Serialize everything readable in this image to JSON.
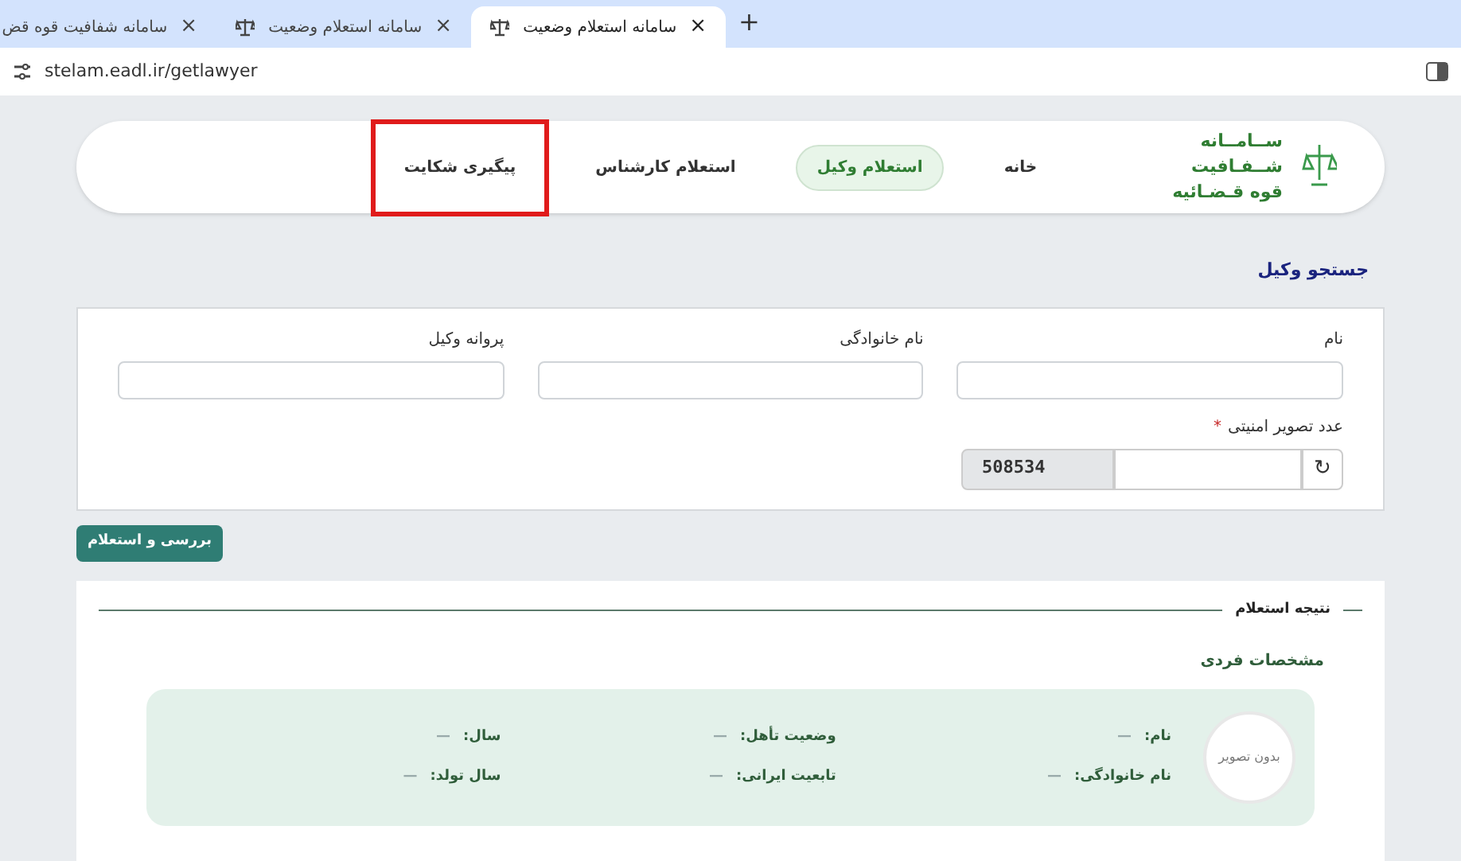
{
  "browser": {
    "tabs": [
      {
        "title": "سامانه استعلام وضعیت",
        "selected": true
      },
      {
        "title": "سامانه استعلام وضعیت",
        "selected": false
      },
      {
        "title": "سامانه شفافیت قوه قض",
        "selected": false
      }
    ],
    "new_tab": "+",
    "close": "×",
    "url": "stelam.eadl.ir/getlawyer"
  },
  "header": {
    "logo_lines": [
      "ســامــانه",
      "شــفـافیت",
      "قوه قـضـائیه"
    ],
    "nav": [
      {
        "label": "خانه",
        "selected": false,
        "highlighted": false
      },
      {
        "label": "استعلام وکیل",
        "selected": true,
        "highlighted": false
      },
      {
        "label": "استعلام کارشناس",
        "selected": false,
        "highlighted": false
      },
      {
        "label": "پیگیری شکایت",
        "selected": false,
        "highlighted": true
      }
    ]
  },
  "search": {
    "title": "جستجو وکیل",
    "fields": [
      {
        "label": "نام"
      },
      {
        "label": "نام خانوادگی"
      },
      {
        "label": "پروانه وکیل"
      }
    ],
    "captcha": {
      "label": "عدد تصویر امنیتی",
      "required_mark": "*",
      "code": "508534",
      "refresh": "↻"
    },
    "submit": "بررسی و استعلام"
  },
  "result": {
    "title": "نتیجه استعلام",
    "section": "مشخصات فردی",
    "photo": "بدون تصویر",
    "items": [
      {
        "label": "نام:",
        "value": "—"
      },
      {
        "label": "وضعیت تأهل:",
        "value": "—"
      },
      {
        "label": "سال:",
        "value": "—"
      },
      {
        "label": "نام خانوادگی:",
        "value": "—"
      },
      {
        "label": "تابعیت ایرانی:",
        "value": "—"
      },
      {
        "label": "سال تولد:",
        "value": "—"
      }
    ]
  }
}
